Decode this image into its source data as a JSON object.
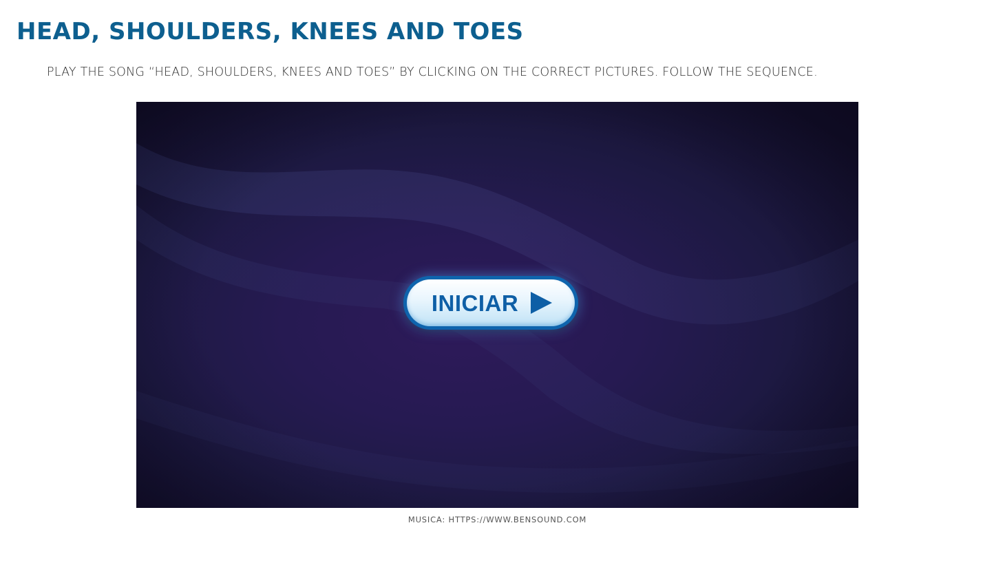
{
  "page": {
    "title": "HEAD, SHOULDERS, KNEES AND TOES",
    "instructions": "PLAY THE SONG “HEAD, SHOULDERS, KNEES AND TOES” BY CLICKING ON THE CORRECT PICTURES. FOLLOW THE SEQUENCE.",
    "credit": "MUSICA: HTTPS://WWW.BENSOUND.COM"
  },
  "game": {
    "start_button_label": "INICIAR",
    "start_button_icon": "play-triangle-icon"
  },
  "colors": {
    "title": "#0d5f8f",
    "button_text": "#0e5fa6",
    "button_border": "#0e64ad",
    "background_dark": "#1d1942",
    "background_purple": "#2e1a5a"
  }
}
